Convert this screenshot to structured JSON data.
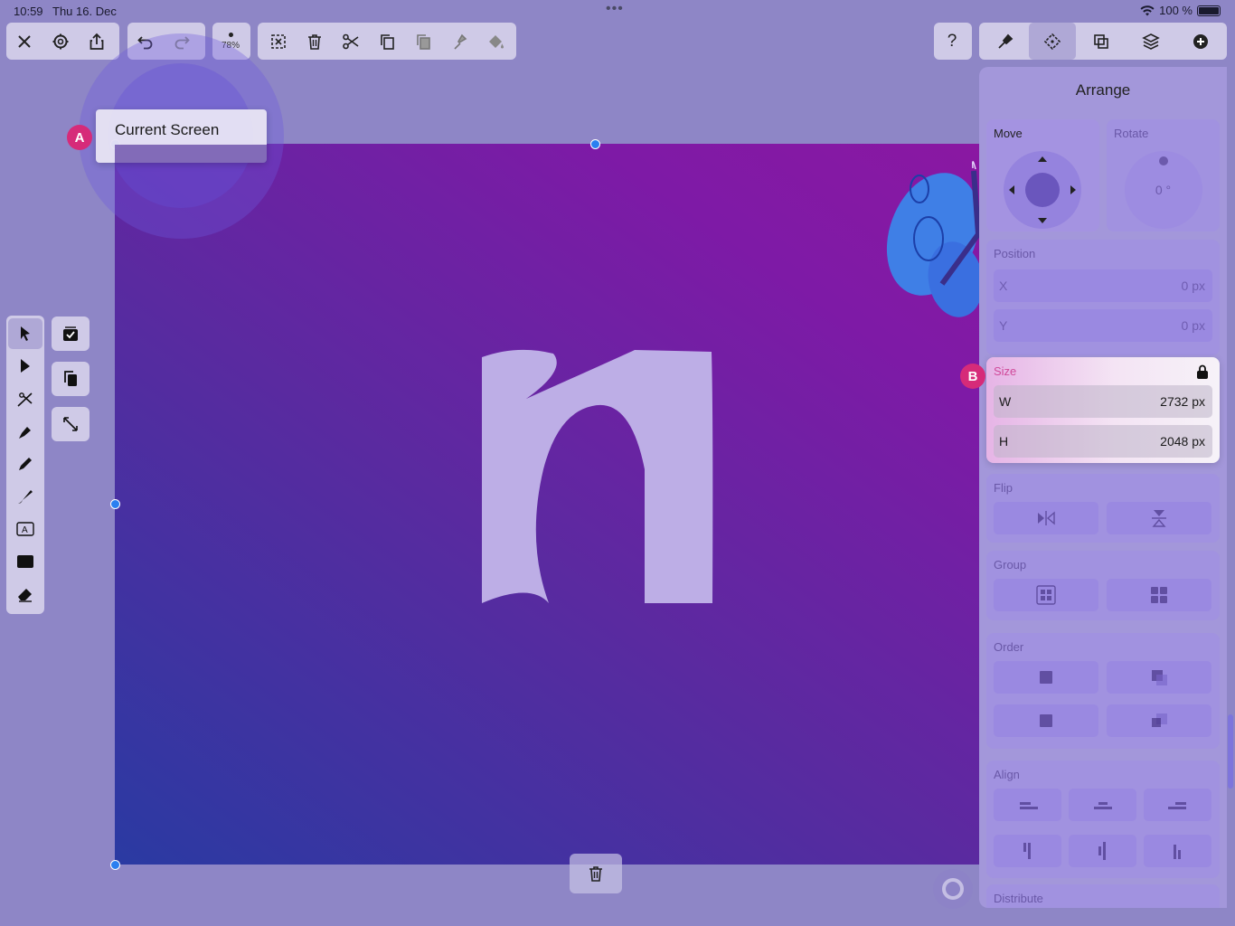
{
  "status": {
    "time": "10:59",
    "date": "Thu 16. Dec",
    "battery": "100 %"
  },
  "toolbar": {
    "zoom": "78%",
    "left_icons": [
      "close-icon",
      "settings-icon",
      "share-icon"
    ],
    "history_icons": [
      "undo-icon",
      "redo-icon"
    ],
    "edit_icons": [
      "deselect-icon",
      "trash-icon",
      "scissors-icon",
      "copy-icon",
      "paste-icon",
      "paste-style-icon",
      "fill-icon"
    ],
    "right_icons": [
      "help-icon",
      "tools-icon",
      "arrange-icon",
      "combine-icon",
      "layers-icon",
      "add-icon"
    ]
  },
  "callout": {
    "label": "Current Screen",
    "badge": "A"
  },
  "badge_b": "B",
  "panel": {
    "title": "Arrange",
    "move": {
      "label": "Move"
    },
    "rotate": {
      "label": "Rotate",
      "value": "0 °"
    },
    "position": {
      "label": "Position",
      "x_label": "X",
      "x_value": "0 px",
      "y_label": "Y",
      "y_value": "0 px"
    },
    "size": {
      "label": "Size",
      "w_label": "W",
      "w_value": "2732 px",
      "h_label": "H",
      "h_value": "2048 px",
      "lock_icon": "lock-icon"
    },
    "flip": {
      "label": "Flip"
    },
    "group": {
      "label": "Group"
    },
    "order": {
      "label": "Order"
    },
    "align": {
      "label": "Align"
    },
    "distribute": {
      "label": "Distribute"
    }
  },
  "colors": {
    "accent": "#d62b79",
    "handle": "#2b7ff0",
    "canvas_start": "#2a3aa2",
    "canvas_end": "#8a18a2"
  }
}
